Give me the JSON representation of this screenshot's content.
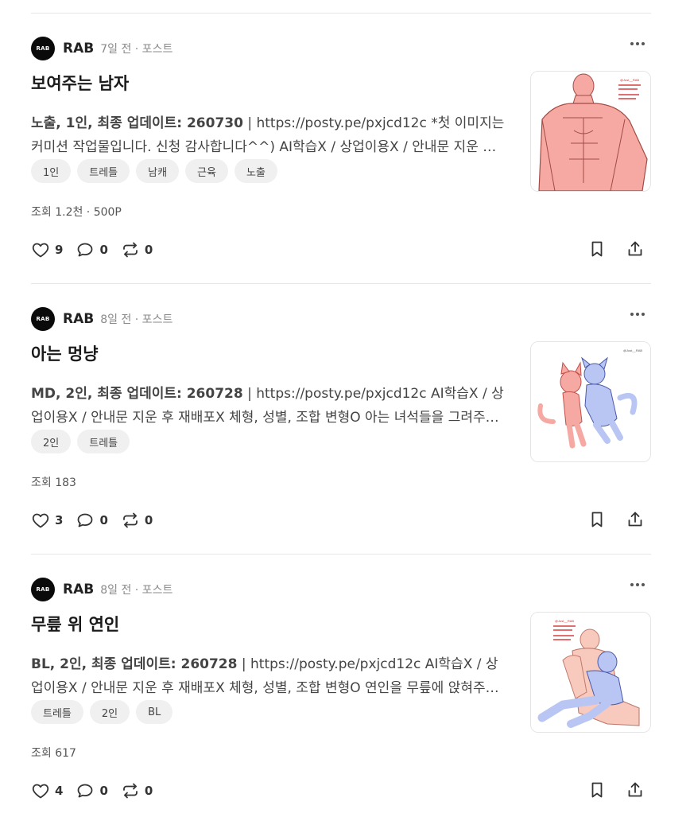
{
  "posts": [
    {
      "author": "RAB",
      "avatar_text": "RAB",
      "meta": "7일 전 · 포스트",
      "title": "보여주는 남자",
      "description_bold": "노출, 1인, 최종 업데이트: 260730",
      "description_rest": " | https://posty.pe/pxjcd12c *첫 이미지는 커미션 작업물입니다. 신청 감사합니다^^) AI학습X / 상업이용X / 안내문 지운 후 재배포X",
      "tags": [
        "1인",
        "트레틀",
        "남캐",
        "근육",
        "노출"
      ],
      "stats": "조회 1.2천 · 500P",
      "likes": "9",
      "comments": "0",
      "reposts": "0",
      "thumb_caption": "@Just__RAB"
    },
    {
      "author": "RAB",
      "avatar_text": "RAB",
      "meta": "8일 전 · 포스트",
      "title": "아는 멍냥",
      "description_bold": "MD, 2인, 최종 업데이트: 260728",
      "description_rest": " | https://posty.pe/pxjcd12c AI학습X / 상업이용X / 안내문 지운 후 재배포X 체형, 성별, 조합 변형O 아는 녀석들을 그려주세요",
      "tags": [
        "2인",
        "트레틀"
      ],
      "stats": "조회 183",
      "likes": "3",
      "comments": "0",
      "reposts": "0",
      "thumb_caption": "@Just__RAB"
    },
    {
      "author": "RAB",
      "avatar_text": "RAB",
      "meta": "8일 전 · 포스트",
      "title": "무릎 위 연인",
      "description_bold": "BL, 2인, 최종 업데이트: 260728",
      "description_rest": " | https://posty.pe/pxjcd12c AI학습X / 상업이용X / 안내문 지운 후 재배포X 체형, 성별, 조합 변형O 연인을 무릎에 앉혀주세요",
      "tags": [
        "트레틀",
        "2인",
        "BL"
      ],
      "stats": "조회 617",
      "likes": "4",
      "comments": "0",
      "reposts": "0",
      "thumb_caption": "@Just__RAB"
    }
  ],
  "icons": {
    "like": "heart-icon",
    "comment": "comment-icon",
    "repost": "repost-icon",
    "bookmark": "bookmark-icon",
    "share": "share-icon",
    "more": "more-icon"
  },
  "colors": {
    "tag_bg": "#f0f0f0",
    "divider": "#e6e6e6",
    "meta_text": "#8a8a8a",
    "pink_figure": "#f6a9a3",
    "blue_figure": "#b9c6f3"
  }
}
